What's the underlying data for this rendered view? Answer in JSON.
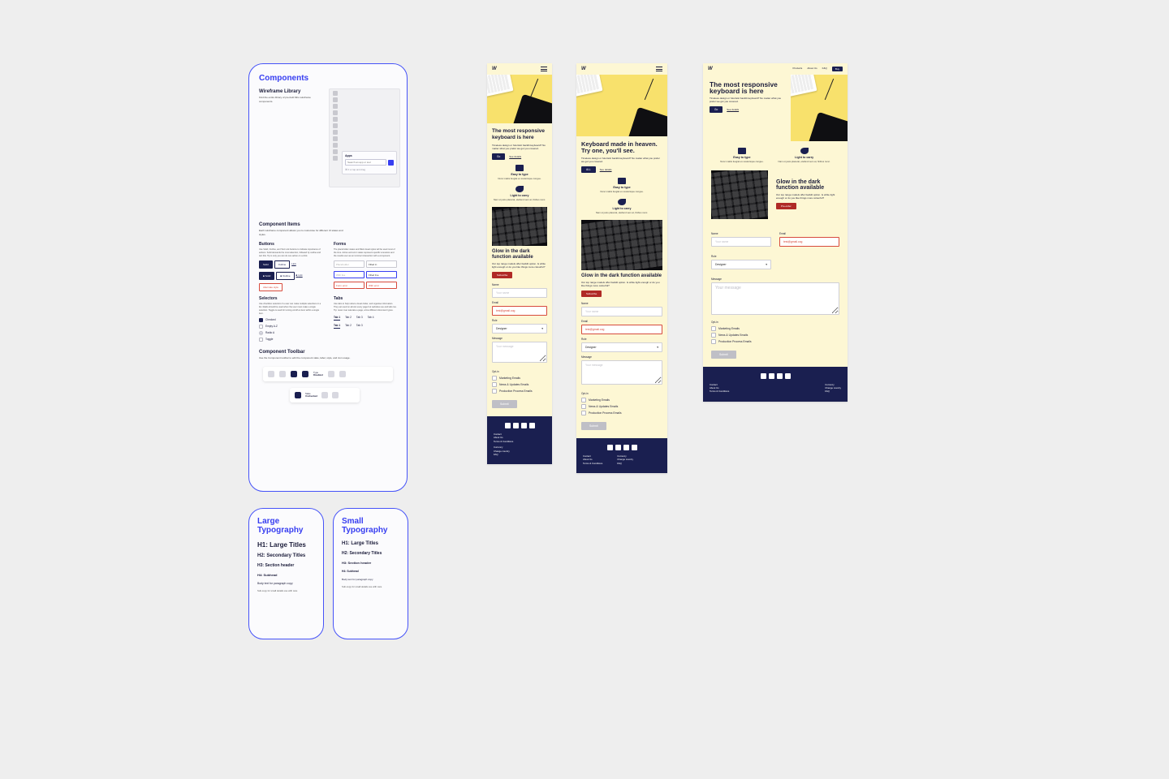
{
  "components_panel": {
    "title": "Components",
    "wf": {
      "heading": "Wireframe Library",
      "desc": "Find the entire library of pre-built Miro wireframe components."
    },
    "apps": {
      "heading": "Apps",
      "placeholder": "Search an app or tool",
      "hint": "⌘ F or tap and drag"
    },
    "ci": {
      "heading": "Component Items",
      "desc": "Each wireframe component allows you to customise for different UI states and styles.",
      "buttons": {
        "title": "Buttons",
        "desc": "Use Solid, Outline, and Text Link buttons to indicate importance of actions. Solid demands the most attention, followed by outline and text link. Tip is only you can do one action on a click.",
        "labels": [
          "Solid",
          "Outline",
          "Link"
        ]
      },
      "forms": {
        "title": "Forms",
        "desc": "The placeholder states and filled visual styles will be used most of the time. Active and error states represent specific scenarios and the results user as an incorrect interaction with a component.",
        "pairs": [
          [
            "Placeholder",
            "Filled in"
          ],
          [
            "With live",
            "Filled live"
          ],
          [
            "Form error",
            "With error"
          ]
        ]
      },
      "selectors": {
        "title": "Selectors",
        "desc": "Use checkbox selectors if a user can make multiple selections in a list. Radio should be used when the user must make a single selection. Toggle is used for turning on/off an item within a single item.",
        "items": [
          {
            "type": "checkbox",
            "checked": true,
            "label": "Checked"
          },
          {
            "type": "checkbox",
            "checked": false,
            "label": "Empty A-Z"
          },
          {
            "type": "radio",
            "checked": true,
            "label": "Radio A"
          },
          {
            "type": "toggle",
            "checked": false,
            "label": "Toggle"
          }
        ]
      },
      "tabs": {
        "title": "Tabs",
        "desc": "Use tabs to help reduce visual clutter, and organise information. They set used on almost every page but websites use and tabs too. Tip: never over saturate a page, a few different document types.",
        "row1": [
          "Tab 1",
          "Tab 2",
          "Tab 3",
          "Tab 4"
        ],
        "row2": [
          "Tab 1",
          "Tab 2",
          "Tab 3"
        ]
      }
    },
    "toolbar": {
      "heading": "Component Toolbar",
      "desc": "Use the Component toolbar to edit the component state, label, style, and icon usage.",
      "type_lbl": "Type",
      "type_val": "Disabled",
      "state_lbl": "State",
      "state_val": "Unchecked"
    }
  },
  "typ_large": {
    "title": "Large Typography",
    "h1": "H1: Large Titles",
    "h2": "H2: Secondary Titles",
    "h3": "H3: Section header",
    "h4": "H4: Subhead",
    "body": "Body text for paragraph copy",
    "sub": "Sub-copy for small details use with care"
  },
  "typ_small": {
    "title": "Small Typography",
    "h1": "H1: Large Titles",
    "h2": "H2: Secondary Titles",
    "h3": "H3: Section header",
    "h4": "H4: Subhead",
    "body": "Body text for paragraph copy",
    "sub": "Sub-copy for small details use with care"
  },
  "product": {
    "nav": {
      "items": [
        "Products",
        "About Us",
        "F&Q"
      ],
      "buy": "Buy"
    },
    "hero": {
      "title_a": "The most responsive keyboard is here",
      "title_b": "Keyboard made in heaven. Try one, you'll see.",
      "lead": "Timeless design or futuristic backlit keyboard? No matter what you prefer we got you covered.",
      "cta": "Go",
      "cta_b": "ALL",
      "ghost": "See details"
    },
    "benefits": {
      "b1": {
        "title": "Easy to type",
        "desc": "Nunc mattis feugiat ex scelerisque congue."
      },
      "b2": {
        "title": "Light to carry",
        "desc": "Nam ut justo placerat, eleifend sem at, finibus nunc."
      }
    },
    "glow": {
      "title": "Glow in the dark function available",
      "desc": "Our top range models offer backlit option. Is white light enough or do you like things more colourful?",
      "cta": "Subscribe",
      "cta_c": "Pre-order"
    },
    "form": {
      "name": {
        "label": "Name",
        "placeholder": "Your name"
      },
      "email": {
        "label": "Email",
        "value": "test@gmail.cog"
      },
      "role": {
        "label": "Role",
        "value": "Designer"
      },
      "message": {
        "label": "Message",
        "placeholder": "Your message"
      },
      "optin": {
        "label": "Opt-in",
        "items": [
          "Marketing Emails",
          "News & Updates Emails",
          "Production Process Emails"
        ]
      },
      "submit": "Submit"
    },
    "footer": {
      "left": [
        "Contact",
        "About Us",
        "Terms & Conditions"
      ],
      "right": [
        "Currency",
        "Change country",
        "FAQ"
      ]
    }
  }
}
